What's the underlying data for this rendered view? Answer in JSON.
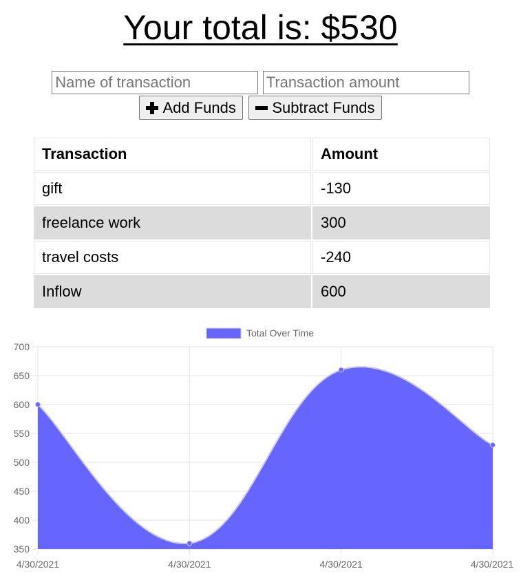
{
  "header": {
    "total_label": "Your total is: $530"
  },
  "form": {
    "name_placeholder": "Name of transaction",
    "amount_placeholder": "Transaction amount",
    "add_label": "Add Funds",
    "subtract_label": "Subtract Funds"
  },
  "table": {
    "headers": [
      "Transaction",
      "Amount"
    ],
    "rows": [
      {
        "name": "gift",
        "amount": "-130"
      },
      {
        "name": "freelance work",
        "amount": "300"
      },
      {
        "name": "travel costs",
        "amount": "-240"
      },
      {
        "name": "Inflow",
        "amount": "600"
      }
    ]
  },
  "colors": {
    "fill": "#6666ff",
    "line": "#c9c9e6",
    "point": "#6666ff",
    "row_alt": "#dcdcdc"
  },
  "chart_data": {
    "type": "area",
    "x": [
      "4/30/2021",
      "4/30/2021",
      "4/30/2021",
      "4/30/2021"
    ],
    "series": [
      {
        "name": "Total Over Time",
        "values": [
          600,
          360,
          660,
          530
        ]
      }
    ],
    "ylim": [
      350,
      700
    ],
    "yticks": [
      350,
      400,
      450,
      500,
      550,
      600,
      650,
      700
    ],
    "grid": true,
    "legend": "top-center",
    "title": "",
    "xlabel": "",
    "ylabel": ""
  }
}
